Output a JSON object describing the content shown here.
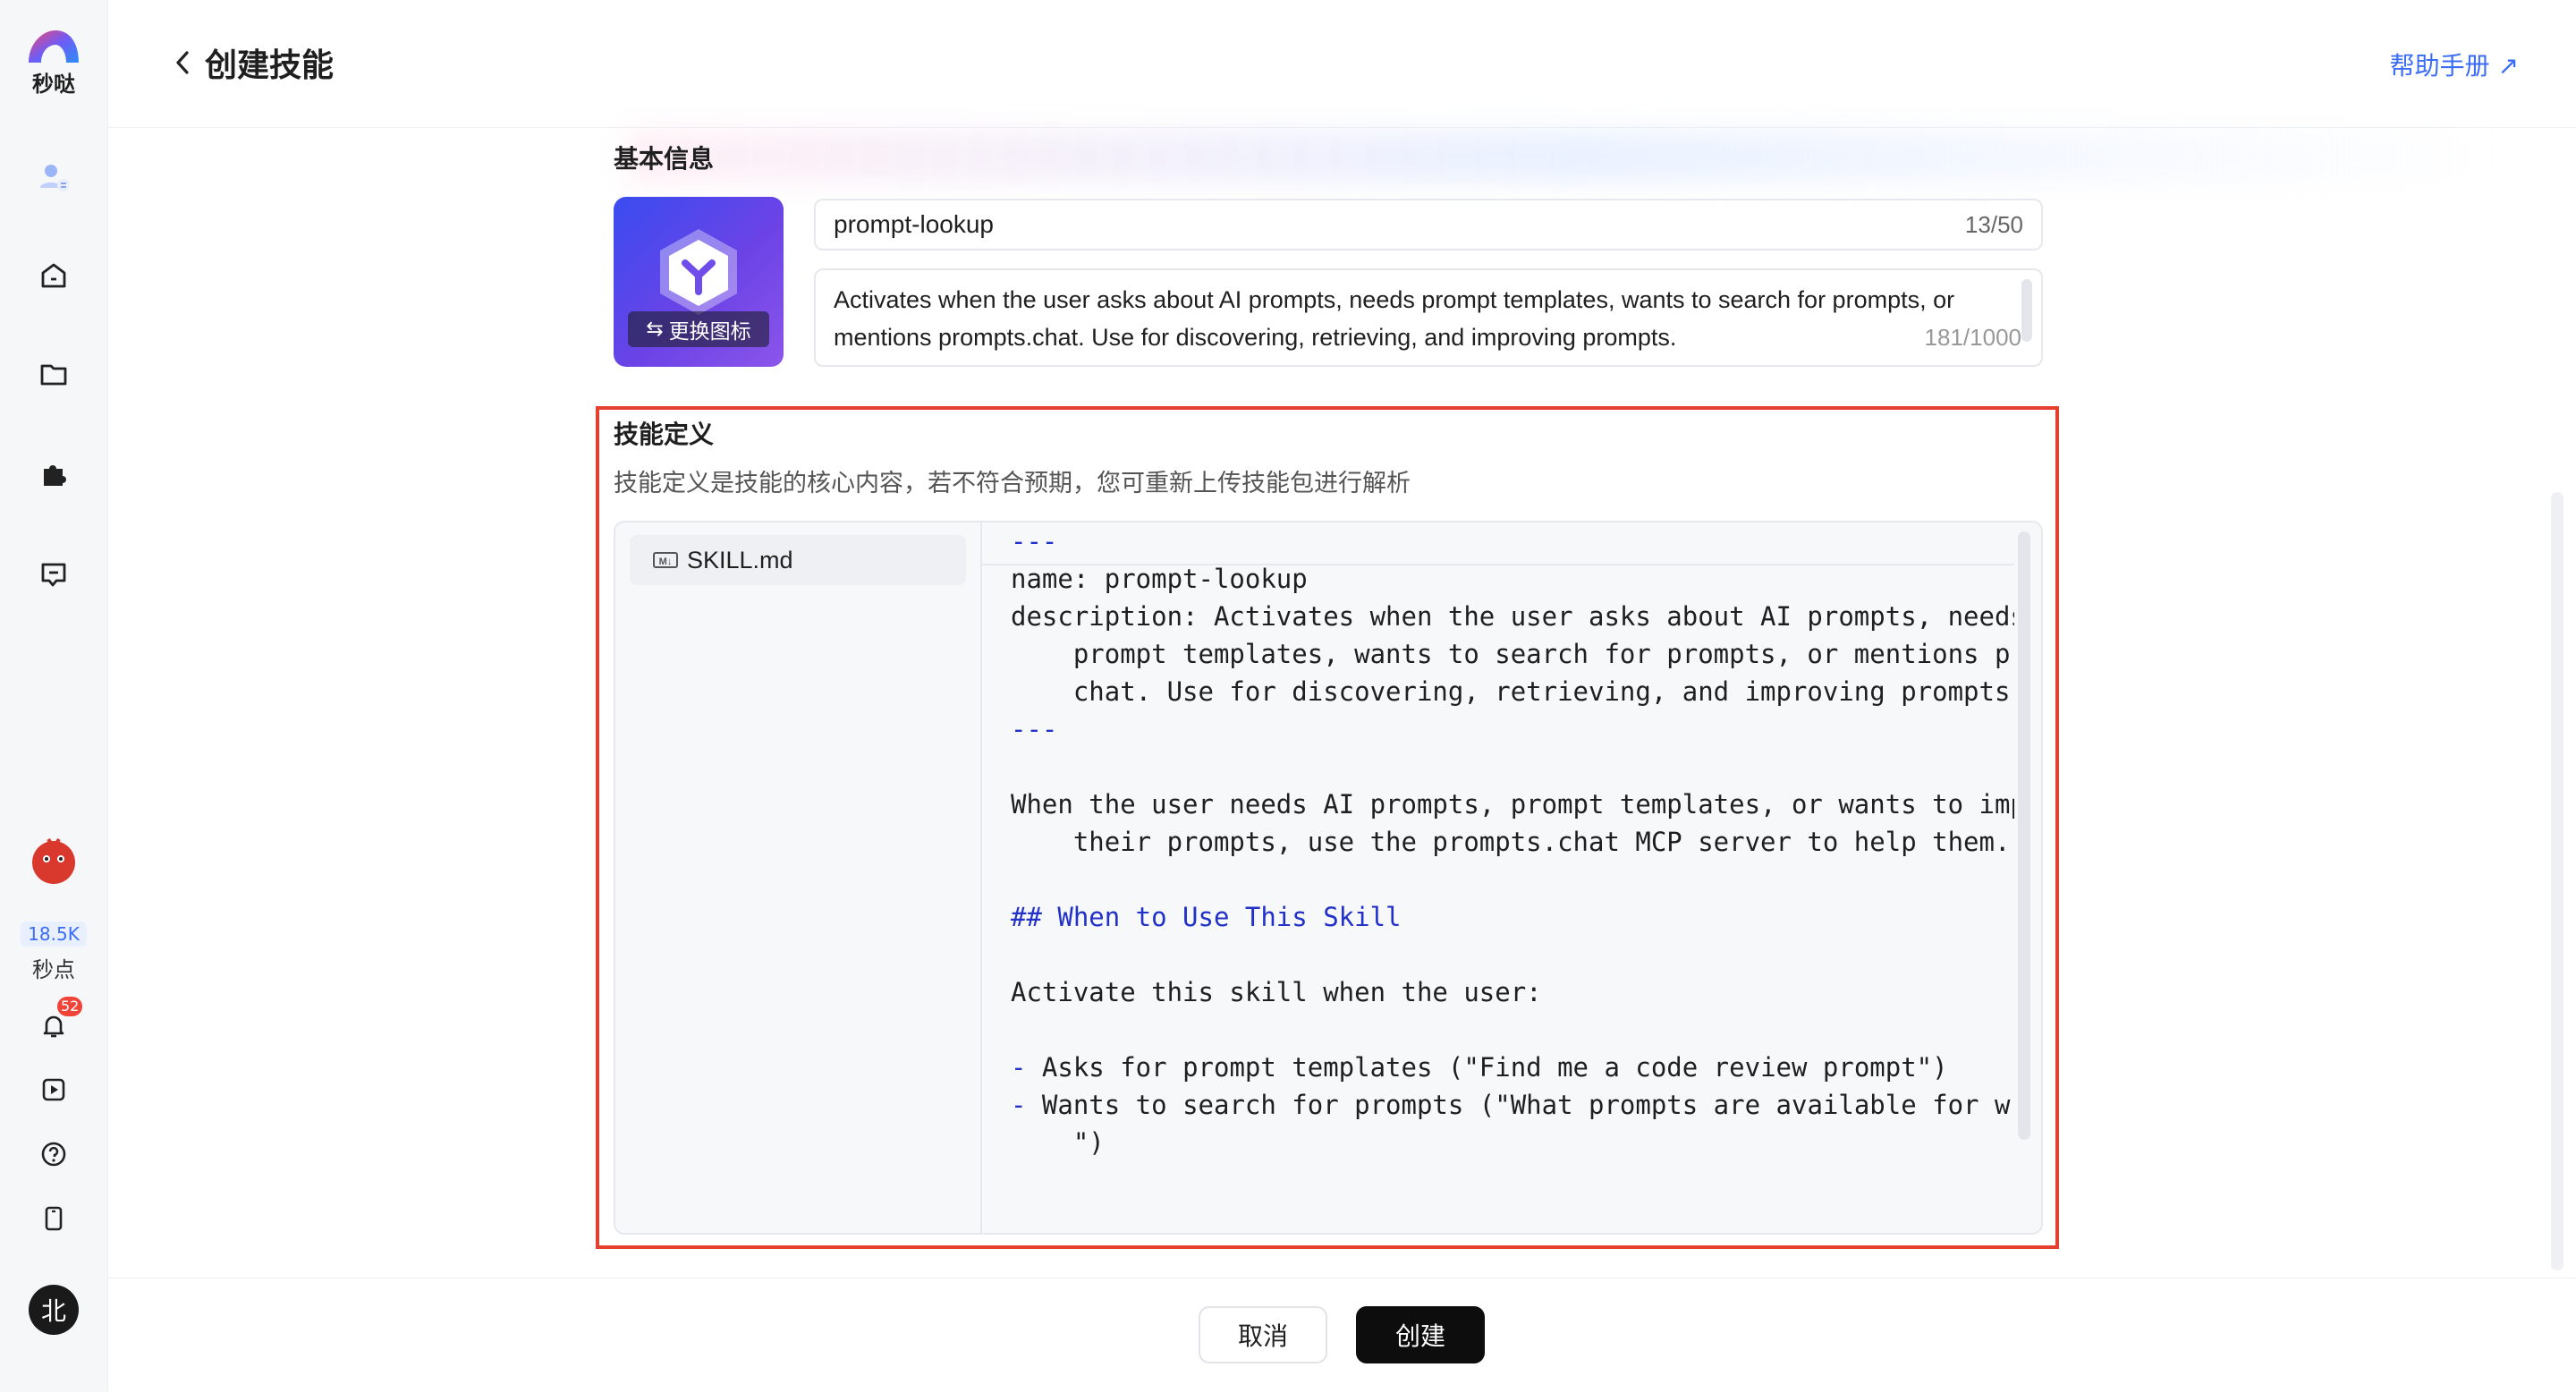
{
  "app": {
    "name": "秒哒"
  },
  "sidebar": {
    "credits_value": "18.5K",
    "credits_label": "秒点",
    "notification_count": "52",
    "user_initial": "北"
  },
  "header": {
    "title": "创建技能",
    "help_link": "帮助手册 ↗"
  },
  "basic_info": {
    "section_title": "基本信息",
    "change_icon_label": "更换图标",
    "name_value": "prompt-lookup",
    "name_count": "13/50",
    "description_value": "Activates when the user asks about AI prompts, needs prompt templates, wants to search for prompts, or mentions prompts.chat. Use for discovering, retrieving, and improving prompts.",
    "description_count": "181/1000"
  },
  "skill_definition": {
    "section_title": "技能定义",
    "description": "技能定义是技能的核心内容，若不符合预期，您可重新上传技能包进行解析",
    "file_name": "SKILL.md",
    "file_icon_text": "M↓",
    "code_lines": [
      "---",
      "name: prompt-lookup",
      "description: Activates when the user asks about AI prompts, needs",
      "    prompt templates, wants to search for prompts, or mentions prom",
      "    chat. Use for discovering, retrieving, and improving prompts.",
      "---",
      "When the user needs AI prompts, prompt templates, or wants to impro",
      "    their prompts, use the prompts.chat MCP server to help them.",
      "## When to Use This Skill",
      "Activate this skill when the user:",
      "- Asks for prompt templates (\"Find me a code review prompt\")",
      "- Wants to search for prompts (\"What prompts are available for writ",
      "    \")"
    ]
  },
  "footer": {
    "cancel_label": "取消",
    "create_label": "创建"
  }
}
